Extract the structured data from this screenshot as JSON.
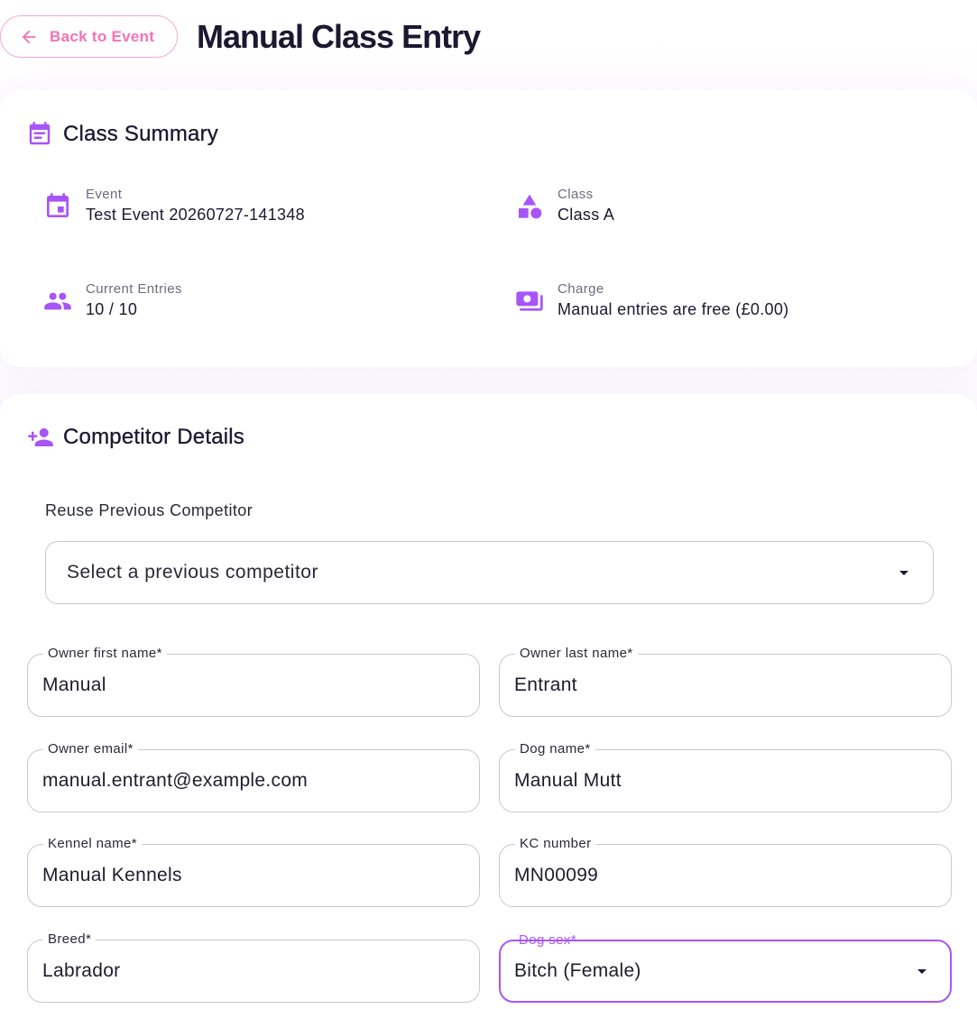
{
  "header": {
    "back_icon": "arrow-back-icon",
    "back_label": "Back to Event",
    "title": "Manual Class Entry"
  },
  "class_summary": {
    "icon": "event-note-icon",
    "title": "Class Summary",
    "items": [
      {
        "icon": "event-icon",
        "label": "Event",
        "value": "Test Event 20260727-141348"
      },
      {
        "icon": "category-icon",
        "label": "Class",
        "value": "Class A"
      },
      {
        "icon": "group-icon",
        "label": "Current Entries",
        "value": "10 / 10"
      },
      {
        "icon": "payments-icon",
        "label": "Charge",
        "value": "Manual entries are free (£0.00)"
      }
    ]
  },
  "competitor_details": {
    "icon": "person-add-icon",
    "title": "Competitor Details",
    "reuse": {
      "label": "Reuse Previous Competitor",
      "placeholder": "Select a previous competitor",
      "icon": "dropdown-arrow-icon"
    },
    "fields": [
      {
        "label": "Owner first name*",
        "value": "Manual"
      },
      {
        "label": "Owner last name*",
        "value": "Entrant"
      },
      {
        "label": "Owner email*",
        "value": "manual.entrant@example.com"
      },
      {
        "label": "Dog name*",
        "value": "Manual Mutt"
      },
      {
        "label": "Kennel name*",
        "value": "Manual Kennels"
      },
      {
        "label": "KC number",
        "value": "MN00099"
      },
      {
        "label": "Breed*",
        "value": "Labrador"
      },
      {
        "label": "Dog sex*",
        "value": "Bitch (Female)",
        "icon": "dropdown-arrow-icon",
        "focused": true
      }
    ]
  },
  "colors": {
    "accent": "#a855f7",
    "back_button": "#f472b6",
    "back_button_border": "#f9a8d4",
    "text": "#1b1830",
    "muted_text": "#6e6b7d"
  }
}
